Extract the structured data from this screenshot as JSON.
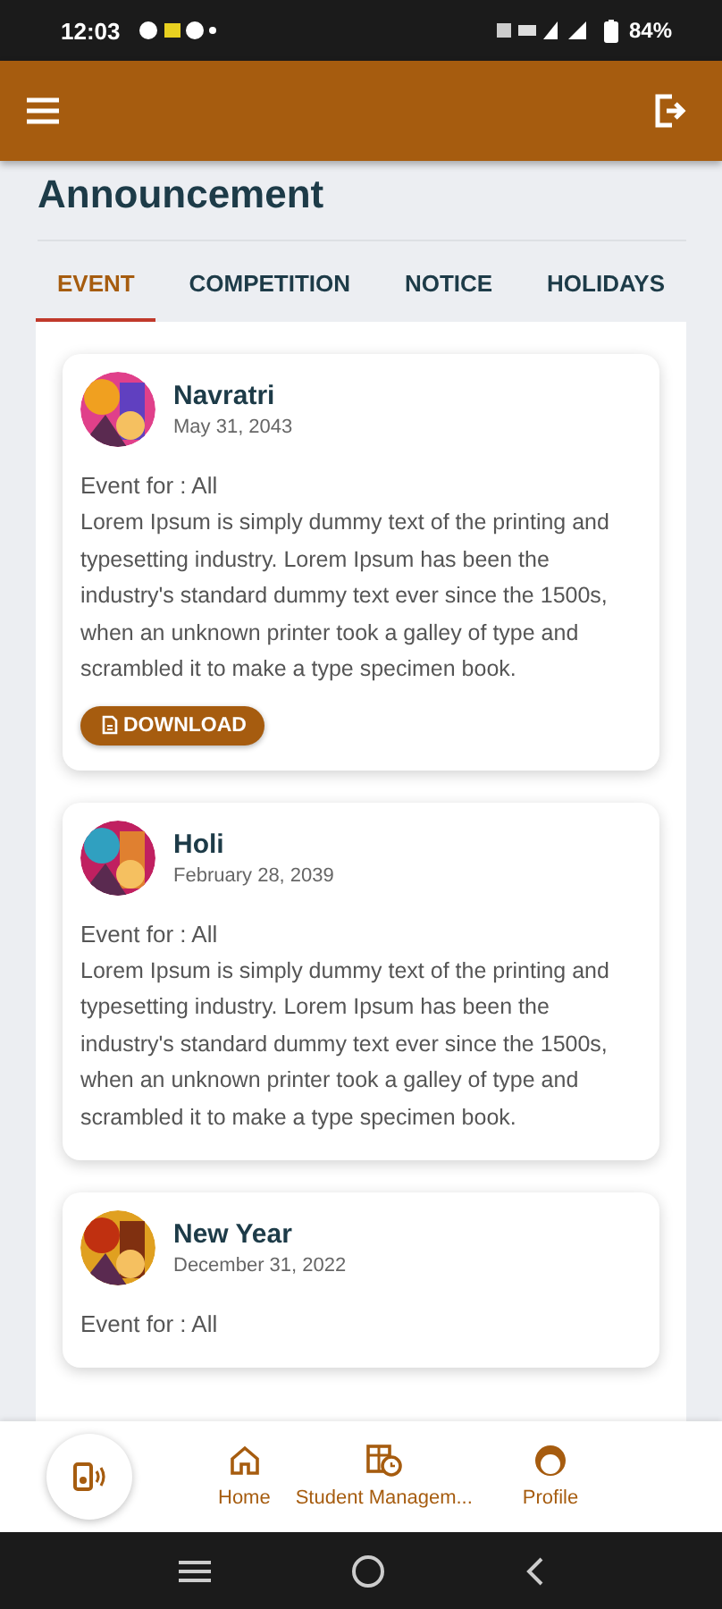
{
  "status_bar": {
    "time": "12:03",
    "battery": "84%"
  },
  "page_title": "Announcement",
  "tabs": [
    {
      "label": "EVENT",
      "selected": true
    },
    {
      "label": "COMPETITION",
      "selected": false
    },
    {
      "label": "NOTICE",
      "selected": false
    },
    {
      "label": "HOLIDAYS",
      "selected": false
    }
  ],
  "announcements": [
    {
      "title": "Navratri",
      "date": "May 31, 2043",
      "audience": "Event for : All",
      "body": "Lorem Ipsum is simply dummy text of the printing and typesetting industry. Lorem Ipsum has been the industry's standard dummy text ever since the 1500s, when an unknown printer took a galley of type and scrambled it to make a type specimen book.",
      "download": "DOWNLOAD"
    },
    {
      "title": "Holi",
      "date": "February 28, 2039",
      "audience": "Event for : All",
      "body": "Lorem Ipsum is simply dummy text of the printing and typesetting industry. Lorem Ipsum has been the industry's standard dummy text ever since the 1500s, when an unknown printer took a galley of type and scrambled it to make a type specimen book."
    },
    {
      "title": "New Year",
      "date": "December 31, 2022",
      "audience": "Event for : All"
    }
  ],
  "bottom_nav": [
    {
      "kind": "home",
      "label": "Home"
    },
    {
      "kind": "management",
      "label": "Student Managem..."
    },
    {
      "kind": "profile",
      "label": "Profile"
    }
  ]
}
